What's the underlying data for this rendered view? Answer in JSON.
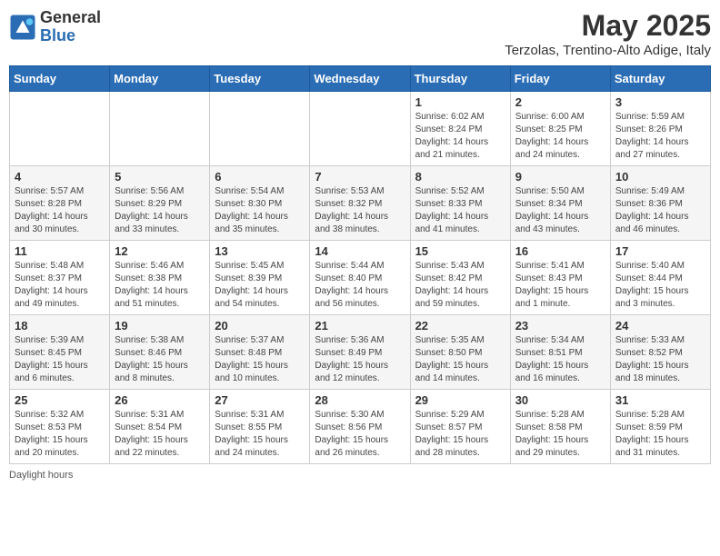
{
  "header": {
    "logo_general": "General",
    "logo_blue": "Blue",
    "month_title": "May 2025",
    "location": "Terzolas, Trentino-Alto Adige, Italy"
  },
  "days_of_week": [
    "Sunday",
    "Monday",
    "Tuesday",
    "Wednesday",
    "Thursday",
    "Friday",
    "Saturday"
  ],
  "weeks": [
    [
      {
        "day": "",
        "info": ""
      },
      {
        "day": "",
        "info": ""
      },
      {
        "day": "",
        "info": ""
      },
      {
        "day": "",
        "info": ""
      },
      {
        "day": "1",
        "info": "Sunrise: 6:02 AM\nSunset: 8:24 PM\nDaylight: 14 hours and 21 minutes."
      },
      {
        "day": "2",
        "info": "Sunrise: 6:00 AM\nSunset: 8:25 PM\nDaylight: 14 hours and 24 minutes."
      },
      {
        "day": "3",
        "info": "Sunrise: 5:59 AM\nSunset: 8:26 PM\nDaylight: 14 hours and 27 minutes."
      }
    ],
    [
      {
        "day": "4",
        "info": "Sunrise: 5:57 AM\nSunset: 8:28 PM\nDaylight: 14 hours and 30 minutes."
      },
      {
        "day": "5",
        "info": "Sunrise: 5:56 AM\nSunset: 8:29 PM\nDaylight: 14 hours and 33 minutes."
      },
      {
        "day": "6",
        "info": "Sunrise: 5:54 AM\nSunset: 8:30 PM\nDaylight: 14 hours and 35 minutes."
      },
      {
        "day": "7",
        "info": "Sunrise: 5:53 AM\nSunset: 8:32 PM\nDaylight: 14 hours and 38 minutes."
      },
      {
        "day": "8",
        "info": "Sunrise: 5:52 AM\nSunset: 8:33 PM\nDaylight: 14 hours and 41 minutes."
      },
      {
        "day": "9",
        "info": "Sunrise: 5:50 AM\nSunset: 8:34 PM\nDaylight: 14 hours and 43 minutes."
      },
      {
        "day": "10",
        "info": "Sunrise: 5:49 AM\nSunset: 8:36 PM\nDaylight: 14 hours and 46 minutes."
      }
    ],
    [
      {
        "day": "11",
        "info": "Sunrise: 5:48 AM\nSunset: 8:37 PM\nDaylight: 14 hours and 49 minutes."
      },
      {
        "day": "12",
        "info": "Sunrise: 5:46 AM\nSunset: 8:38 PM\nDaylight: 14 hours and 51 minutes."
      },
      {
        "day": "13",
        "info": "Sunrise: 5:45 AM\nSunset: 8:39 PM\nDaylight: 14 hours and 54 minutes."
      },
      {
        "day": "14",
        "info": "Sunrise: 5:44 AM\nSunset: 8:40 PM\nDaylight: 14 hours and 56 minutes."
      },
      {
        "day": "15",
        "info": "Sunrise: 5:43 AM\nSunset: 8:42 PM\nDaylight: 14 hours and 59 minutes."
      },
      {
        "day": "16",
        "info": "Sunrise: 5:41 AM\nSunset: 8:43 PM\nDaylight: 15 hours and 1 minute."
      },
      {
        "day": "17",
        "info": "Sunrise: 5:40 AM\nSunset: 8:44 PM\nDaylight: 15 hours and 3 minutes."
      }
    ],
    [
      {
        "day": "18",
        "info": "Sunrise: 5:39 AM\nSunset: 8:45 PM\nDaylight: 15 hours and 6 minutes."
      },
      {
        "day": "19",
        "info": "Sunrise: 5:38 AM\nSunset: 8:46 PM\nDaylight: 15 hours and 8 minutes."
      },
      {
        "day": "20",
        "info": "Sunrise: 5:37 AM\nSunset: 8:48 PM\nDaylight: 15 hours and 10 minutes."
      },
      {
        "day": "21",
        "info": "Sunrise: 5:36 AM\nSunset: 8:49 PM\nDaylight: 15 hours and 12 minutes."
      },
      {
        "day": "22",
        "info": "Sunrise: 5:35 AM\nSunset: 8:50 PM\nDaylight: 15 hours and 14 minutes."
      },
      {
        "day": "23",
        "info": "Sunrise: 5:34 AM\nSunset: 8:51 PM\nDaylight: 15 hours and 16 minutes."
      },
      {
        "day": "24",
        "info": "Sunrise: 5:33 AM\nSunset: 8:52 PM\nDaylight: 15 hours and 18 minutes."
      }
    ],
    [
      {
        "day": "25",
        "info": "Sunrise: 5:32 AM\nSunset: 8:53 PM\nDaylight: 15 hours and 20 minutes."
      },
      {
        "day": "26",
        "info": "Sunrise: 5:31 AM\nSunset: 8:54 PM\nDaylight: 15 hours and 22 minutes."
      },
      {
        "day": "27",
        "info": "Sunrise: 5:31 AM\nSunset: 8:55 PM\nDaylight: 15 hours and 24 minutes."
      },
      {
        "day": "28",
        "info": "Sunrise: 5:30 AM\nSunset: 8:56 PM\nDaylight: 15 hours and 26 minutes."
      },
      {
        "day": "29",
        "info": "Sunrise: 5:29 AM\nSunset: 8:57 PM\nDaylight: 15 hours and 28 minutes."
      },
      {
        "day": "30",
        "info": "Sunrise: 5:28 AM\nSunset: 8:58 PM\nDaylight: 15 hours and 29 minutes."
      },
      {
        "day": "31",
        "info": "Sunrise: 5:28 AM\nSunset: 8:59 PM\nDaylight: 15 hours and 31 minutes."
      }
    ]
  ],
  "footer": {
    "note": "Daylight hours"
  }
}
